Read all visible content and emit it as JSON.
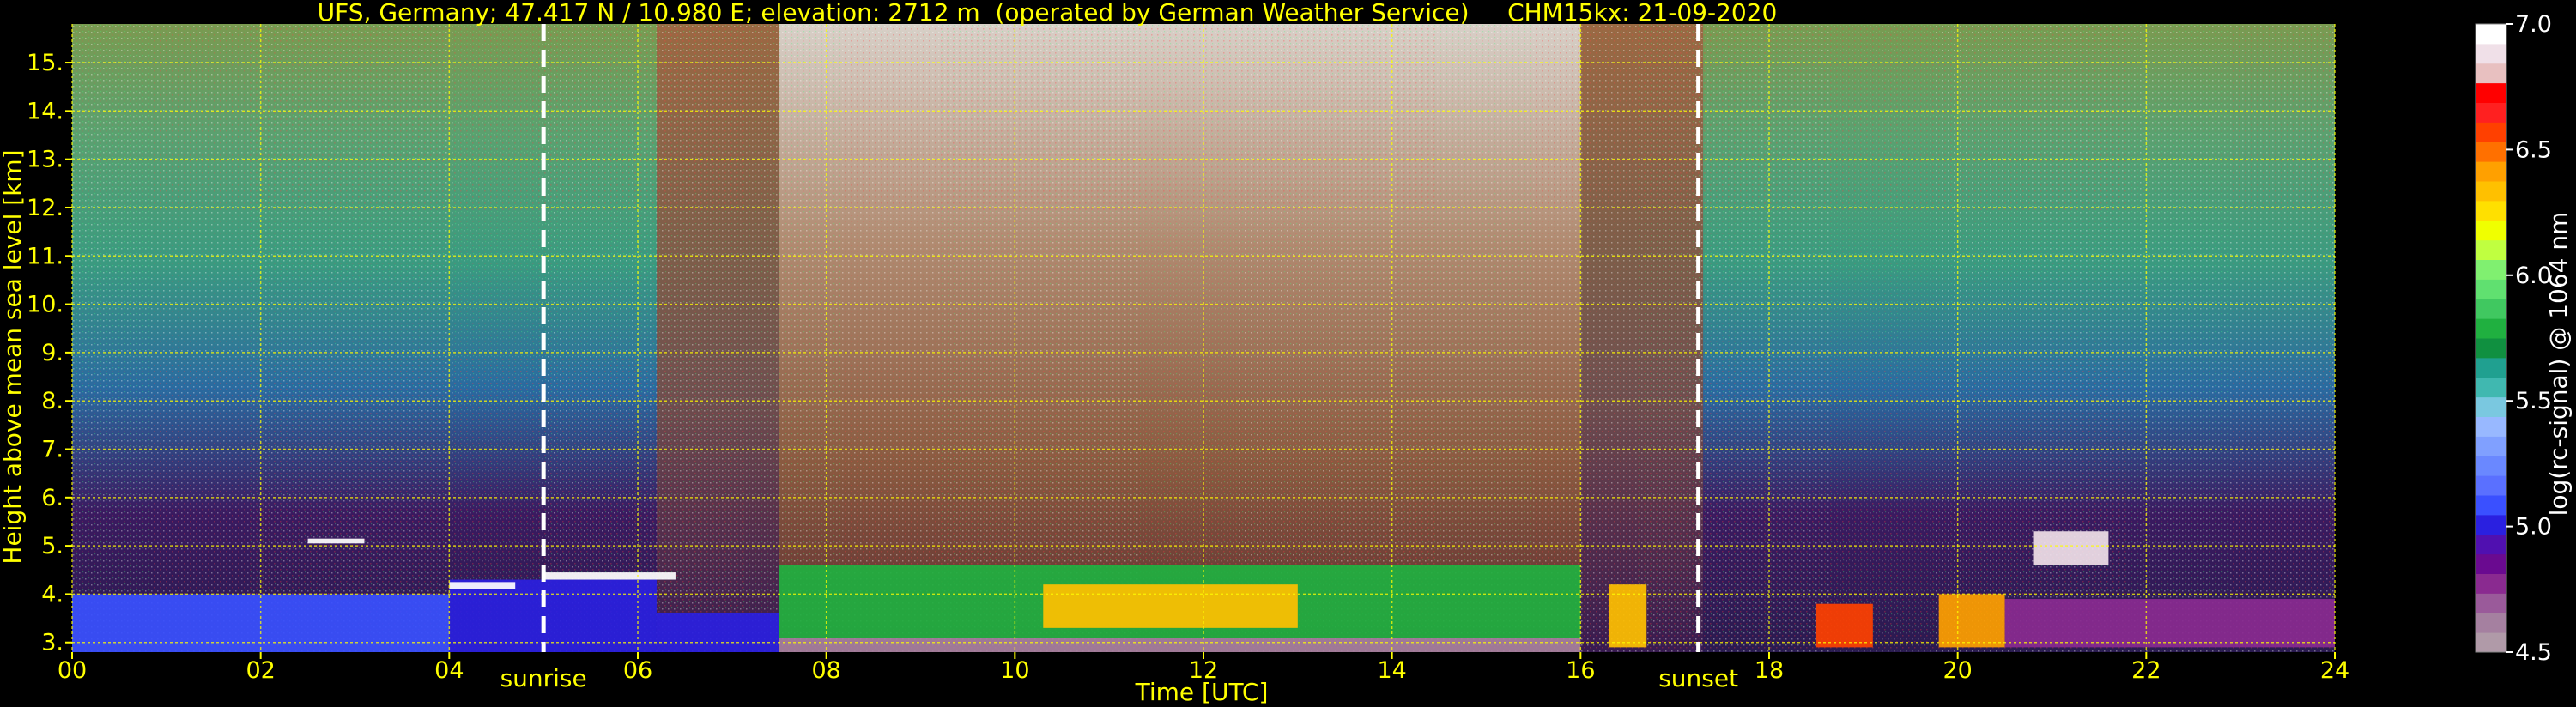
{
  "chart_data": {
    "type": "heatmap",
    "title": "UFS, Germany; 47.417 N / 10.980 E; elevation: 2712 m  (operated by German Weather Service)     CHM15kx: 21-09-2020",
    "xlabel": "Time [UTC]",
    "ylabel": "Height above mean sea level [km]",
    "xlim": [
      0,
      24
    ],
    "ylim": [
      2.8,
      15.8
    ],
    "x_ticks": [
      "00",
      "02",
      "04",
      "06",
      "08",
      "10",
      "12",
      "14",
      "16",
      "18",
      "20",
      "22",
      "24"
    ],
    "x_tick_values": [
      0,
      2,
      4,
      6,
      8,
      10,
      12,
      14,
      16,
      18,
      20,
      22,
      24
    ],
    "y_ticks": [
      "3.",
      "4.",
      "5.",
      "6.",
      "7.",
      "8.",
      "9.",
      "10.",
      "11.",
      "12.",
      "13.",
      "14.",
      "15."
    ],
    "y_tick_values": [
      3,
      4,
      5,
      6,
      7,
      8,
      9,
      10,
      11,
      12,
      13,
      14,
      15
    ],
    "grid": true,
    "annotations": [
      {
        "text": "sunrise",
        "x": 5.0
      },
      {
        "text": "sunset",
        "x": 17.25
      }
    ],
    "colorbar": {
      "label": "log(rc-signal) @ 1064 nm",
      "range": [
        4.5,
        7.0
      ],
      "tick_labels": [
        "4.5",
        "5.0",
        "5.5",
        "6.0",
        "6.5",
        "7.0"
      ],
      "tick_values": [
        4.5,
        5.0,
        5.5,
        6.0,
        6.5,
        7.0
      ],
      "colors": [
        "#b09aa8",
        "#a580a0",
        "#9a5a9a",
        "#8a2a90",
        "#6a0a90",
        "#5010b0",
        "#2a20e0",
        "#3a50ff",
        "#5a70ff",
        "#6a88ff",
        "#80a0ff",
        "#98b8ff",
        "#7ac8e0",
        "#40b8b0",
        "#20a090",
        "#109040",
        "#20b040",
        "#40c860",
        "#60e070",
        "#80f070",
        "#c0ff40",
        "#f0ff00",
        "#ffe000",
        "#ffc000",
        "#ffa000",
        "#ff7000",
        "#ff4000",
        "#ff2020",
        "#ff0000",
        "#e8c0c0",
        "#f0e0e8",
        "#ffffff"
      ]
    },
    "regions": [
      {
        "x0": 0,
        "x1": 4,
        "y0": 2.8,
        "y1": 4.0,
        "value": 5.1
      },
      {
        "x0": 4,
        "x1": 6.2,
        "y0": 2.8,
        "y1": 4.3,
        "value": 5.0
      },
      {
        "x0": 6.2,
        "x1": 7.5,
        "y0": 2.8,
        "y1": 3.6,
        "value": 5.0
      },
      {
        "x0": 7.5,
        "x1": 16,
        "y0": 2.8,
        "y1": 3.1,
        "value": 4.6
      },
      {
        "x0": 7.5,
        "x1": 16,
        "y0": 3.1,
        "y1": 4.6,
        "value": 5.8
      },
      {
        "x0": 10.3,
        "x1": 13.0,
        "y0": 3.3,
        "y1": 4.2,
        "value": 6.3
      },
      {
        "x0": 16.3,
        "x1": 16.7,
        "y0": 2.9,
        "y1": 4.2,
        "value": 6.3
      },
      {
        "x0": 18.5,
        "x1": 19.1,
        "y0": 2.9,
        "y1": 3.8,
        "value": 6.6
      },
      {
        "x0": 19.8,
        "x1": 20.5,
        "y0": 2.9,
        "y1": 4.0,
        "value": 6.4
      },
      {
        "x0": 20.5,
        "x1": 24,
        "y0": 2.9,
        "y1": 3.9,
        "value": 4.8
      },
      {
        "x0": 2.5,
        "x1": 3.1,
        "y0": 5.05,
        "y1": 5.15,
        "value": 7.0
      },
      {
        "x0": 4.0,
        "x1": 4.7,
        "y0": 4.1,
        "y1": 4.25,
        "value": 7.0
      },
      {
        "x0": 5.0,
        "x1": 6.4,
        "y0": 4.3,
        "y1": 4.45,
        "value": 7.0
      },
      {
        "x0": 20.8,
        "x1": 21.6,
        "y0": 4.6,
        "y1": 5.3,
        "value": 6.9
      }
    ]
  }
}
